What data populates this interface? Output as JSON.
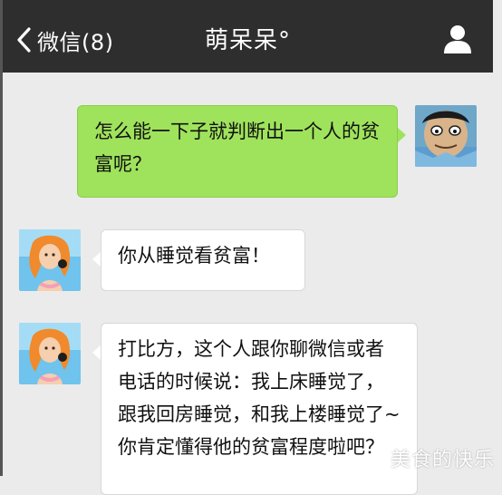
{
  "header": {
    "back_label": "微信(8)",
    "title": "萌呆呆°"
  },
  "messages": [
    {
      "sender": "self",
      "text": "怎么能一下子就判断出一个人的贫富呢？"
    },
    {
      "sender": "contact",
      "text": "你从睡觉看贫富！"
    },
    {
      "sender": "contact",
      "text": "打比方，这个人跟你聊微信或者电话的时候说：我上床睡觉了，跟我回房睡觉，和我上楼睡觉了~你肯定懂得他的贫富程度啦吧？"
    }
  ],
  "watermark": "美食的快乐",
  "colors": {
    "topbar": "#2e2e2f",
    "chat_background": "#ebebeb",
    "outgoing_bubble": "#9fe35c",
    "incoming_bubble": "#ffffff"
  },
  "icons": {
    "back": "chevron-left-icon",
    "profile": "person-icon"
  }
}
